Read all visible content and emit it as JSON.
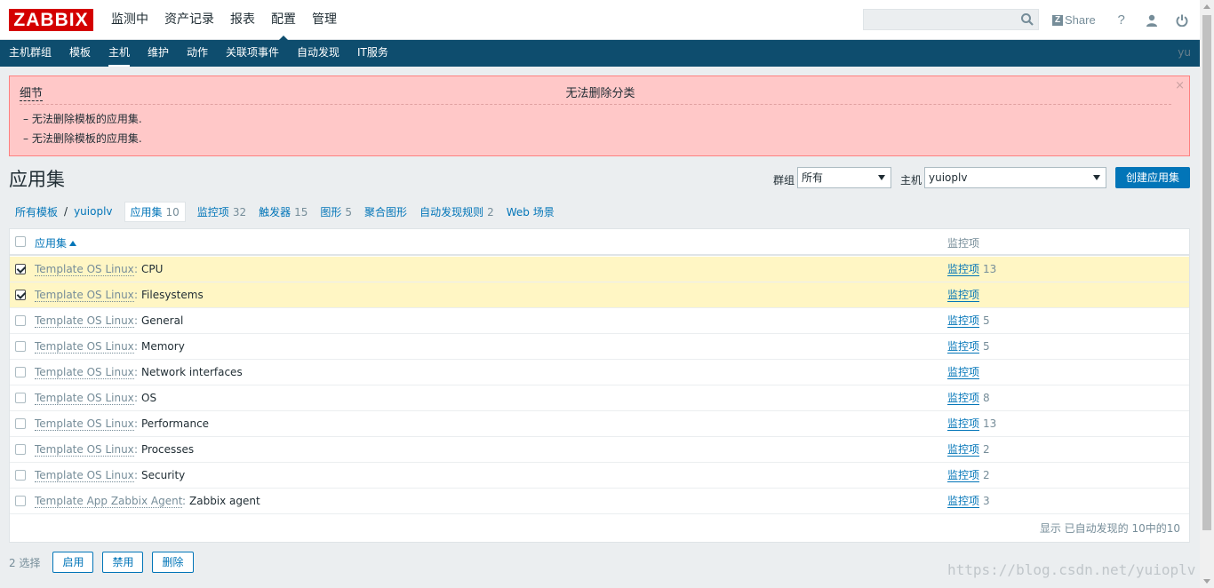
{
  "brand": {
    "logo": "ZABBIX"
  },
  "main_menu": [
    {
      "label": "监测中"
    },
    {
      "label": "资产记录"
    },
    {
      "label": "报表"
    },
    {
      "label": "配置",
      "active": true
    },
    {
      "label": "管理"
    }
  ],
  "search": {
    "placeholder": "",
    "value": ""
  },
  "top_right": {
    "share": "Share",
    "help": "?"
  },
  "sub_menu": [
    {
      "label": "主机群组"
    },
    {
      "label": "模板"
    },
    {
      "label": "主机",
      "active": true
    },
    {
      "label": "维护"
    },
    {
      "label": "动作"
    },
    {
      "label": "关联项事件"
    },
    {
      "label": "自动发现"
    },
    {
      "label": "IT服务"
    }
  ],
  "user": "yu",
  "message": {
    "details_label": "细节",
    "title": "无法删除分类",
    "close": "×",
    "lines": [
      "–  无法删除模板的应用集.",
      "–  无法删除模板的应用集."
    ]
  },
  "page_title": "应用集",
  "filters": {
    "group_label": "群组",
    "group_value": "所有",
    "host_label": "主机",
    "host_value": "yuioplv"
  },
  "create_button": "创建应用集",
  "breadcrumbs": {
    "all_templates": "所有模板",
    "separator": "/",
    "host": "yuioplv",
    "tabs": [
      {
        "label": "应用集",
        "count": "10",
        "active": true
      },
      {
        "label": "监控项",
        "count": "32"
      },
      {
        "label": "触发器",
        "count": "15"
      },
      {
        "label": "图形",
        "count": "5"
      },
      {
        "label": "聚合图形",
        "count": ""
      },
      {
        "label": "自动发现规则",
        "count": "2"
      },
      {
        "label": "Web 场景",
        "count": ""
      }
    ]
  },
  "table": {
    "col_name": "应用集",
    "col_items": "监控项",
    "rows": [
      {
        "template": "Template OS Linux",
        "name": "CPU",
        "items_label": "监控项",
        "items_count": "13",
        "checked": true
      },
      {
        "template": "Template OS Linux",
        "name": "Filesystems",
        "items_label": "监控项",
        "items_count": "",
        "checked": true
      },
      {
        "template": "Template OS Linux",
        "name": "General",
        "items_label": "监控项",
        "items_count": "5",
        "checked": false
      },
      {
        "template": "Template OS Linux",
        "name": "Memory",
        "items_label": "监控项",
        "items_count": "5",
        "checked": false
      },
      {
        "template": "Template OS Linux",
        "name": "Network interfaces",
        "items_label": "监控项",
        "items_count": "",
        "checked": false
      },
      {
        "template": "Template OS Linux",
        "name": "OS",
        "items_label": "监控项",
        "items_count": "8",
        "checked": false
      },
      {
        "template": "Template OS Linux",
        "name": "Performance",
        "items_label": "监控项",
        "items_count": "13",
        "checked": false
      },
      {
        "template": "Template OS Linux",
        "name": "Processes",
        "items_label": "监控项",
        "items_count": "2",
        "checked": false
      },
      {
        "template": "Template OS Linux",
        "name": "Security",
        "items_label": "监控项",
        "items_count": "2",
        "checked": false
      },
      {
        "template": "Template App Zabbix Agent",
        "name": "Zabbix agent",
        "items_label": "监控项",
        "items_count": "3",
        "checked": false
      }
    ],
    "footer": "显示 已自动发现的 10中的10"
  },
  "actions": {
    "selected": "2 选择",
    "enable": "启用",
    "disable": "禁用",
    "delete": "删除"
  },
  "watermark": "https://blog.csdn.net/yuioplv",
  "colors": {
    "brand_red": "#d40000",
    "nav_blue": "#0e4d6e",
    "link_blue": "#0275b8",
    "error_bg": "#ffc8c8",
    "selected_row": "#fff6c4"
  }
}
